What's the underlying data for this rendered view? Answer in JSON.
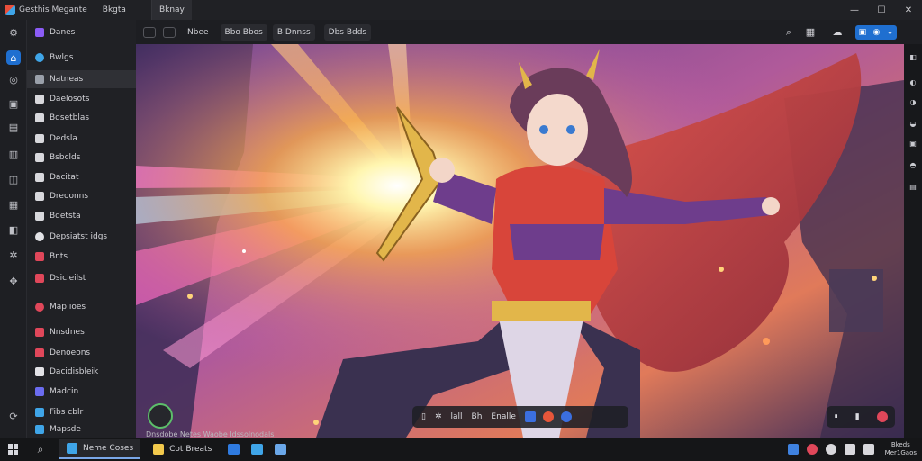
{
  "titlebar": {
    "app_name": "Gesthis Megante",
    "tabs": [
      "Bkgta",
      "Bknay"
    ],
    "controls": [
      "—",
      "☐",
      "✕"
    ]
  },
  "rail_icons": [
    "settings-icon",
    "home-icon",
    "globe-icon",
    "image-icon",
    "folder-icon",
    "document-icon",
    "chat-icon",
    "table-icon",
    "puzzle-icon",
    "gear-icon",
    "robot-icon"
  ],
  "sidebar": {
    "items": [
      {
        "label": "Danes",
        "color": "#8b5cf6"
      },
      {
        "label": "Bwlgs",
        "color": "#3fa5e8"
      },
      {
        "label": "Natneas",
        "color": "#9aa0aa"
      },
      {
        "label": "Daelosots",
        "color": "#d8d8dc"
      },
      {
        "label": "Bdsetblas",
        "color": "#d8d8dc"
      },
      {
        "label": "Dedsla",
        "color": "#d8d8dc"
      },
      {
        "label": "Bsbclds",
        "color": "#d8d8dc"
      },
      {
        "label": "Dacitat",
        "color": "#d8d8dc"
      },
      {
        "label": "Dreoonns",
        "color": "#d8d8dc"
      },
      {
        "label": "Bdetsta",
        "color": "#d8d8dc"
      },
      {
        "label": "Depsiatst idgs",
        "color": "#e2e2e6"
      },
      {
        "label": "Bnts",
        "color": "#e0475a"
      },
      {
        "label": "Dsicleilst",
        "color": "#e0475a"
      },
      {
        "label": "Map ioes",
        "color": "#e0475a"
      },
      {
        "label": "Nnsdnes",
        "color": "#e0475a"
      },
      {
        "label": "Denoeons",
        "color": "#e0475a"
      },
      {
        "label": "Dacidisbleik",
        "color": "#e2e2e6"
      },
      {
        "label": "Madcin",
        "color": "#6b6cf0"
      },
      {
        "label": "Fibs cblr",
        "color": "#3fa5e8"
      },
      {
        "label": "Mapsde",
        "color": "#3fa5e8"
      }
    ]
  },
  "toolbar": {
    "buttons": [
      "Nbee",
      "Bbo Bbos",
      "B Dnnss",
      "Dbs Bdds"
    ],
    "right_icons": [
      "search-icon",
      "grid-icon",
      "cloud-icon"
    ],
    "pill": [
      "▣",
      "◉",
      "⌄"
    ]
  },
  "bottom_pill": {
    "labels": [
      "lall",
      "Bh",
      "Enalle"
    ],
    "dot_colors": [
      "#3b6fe0",
      "#e8563a",
      "#3b6fe0"
    ]
  },
  "right_pill": {
    "labels": [
      "⏸",
      "▮"
    ],
    "dot_color": "#e0475a"
  },
  "filmstrip_text": "Dnsdobe Netes Waobe ldssolnodals",
  "taskbar": {
    "apps": [
      {
        "label": "Neme Coses",
        "color": "#3fa5e8",
        "active": true
      },
      {
        "label": "Cot Breats",
        "color": "#f2c94c",
        "active": false
      }
    ],
    "pinned_colors": [
      "#2f7be0",
      "#3fa5e8",
      "#6aa7e8"
    ],
    "tray_colors": [
      "#3f82e0",
      "#e0475a",
      "#d8d8dc",
      "#d8d8dc",
      "#d8d8dc"
    ],
    "clock": [
      "Bkeds",
      "Mer1Gaos"
    ]
  }
}
